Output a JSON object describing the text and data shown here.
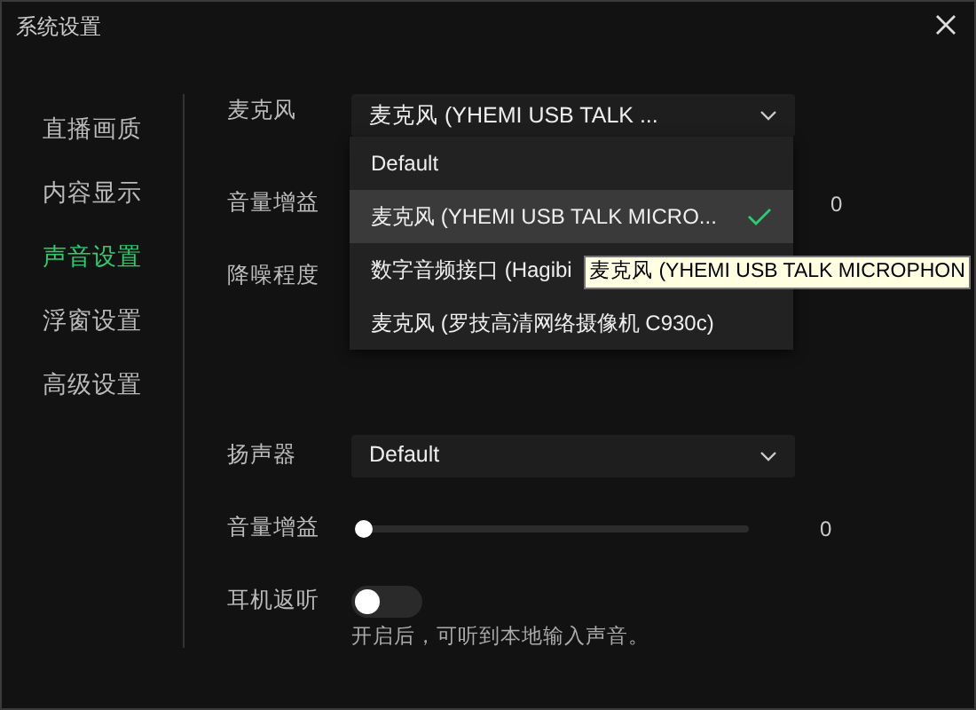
{
  "window": {
    "title": "系统设置"
  },
  "sidebar": {
    "items": [
      {
        "label": "直播画质",
        "selected": false
      },
      {
        "label": "内容显示",
        "selected": false
      },
      {
        "label": "声音设置",
        "selected": true
      },
      {
        "label": "浮窗设置",
        "selected": false
      },
      {
        "label": "高级设置",
        "selected": false
      }
    ]
  },
  "microphone": {
    "label": "麦克风",
    "value": "麦克风 (YHEMI USB TALK ...",
    "options": [
      {
        "label": "Default",
        "selected": false
      },
      {
        "label": "麦克风 (YHEMI USB TALK MICRO...",
        "selected": true
      },
      {
        "label": "数字音频接口 (Hagibi",
        "selected": false
      },
      {
        "label": "麦克风 (罗技高清网络摄像机 C930c)",
        "selected": false
      }
    ],
    "tooltip": "麦克风 (YHEMI USB TALK MICROPHON"
  },
  "mic_gain": {
    "label": "音量增益",
    "reading": "0"
  },
  "noise_reduction": {
    "label": "降噪程度"
  },
  "speaker": {
    "label": "扬声器",
    "value": "Default"
  },
  "speaker_gain": {
    "label": "音量增益",
    "level": 0,
    "reading": "0"
  },
  "monitoring": {
    "label": "耳机返听",
    "on": false,
    "hint": "开启后，可听到本地输入声音。"
  }
}
